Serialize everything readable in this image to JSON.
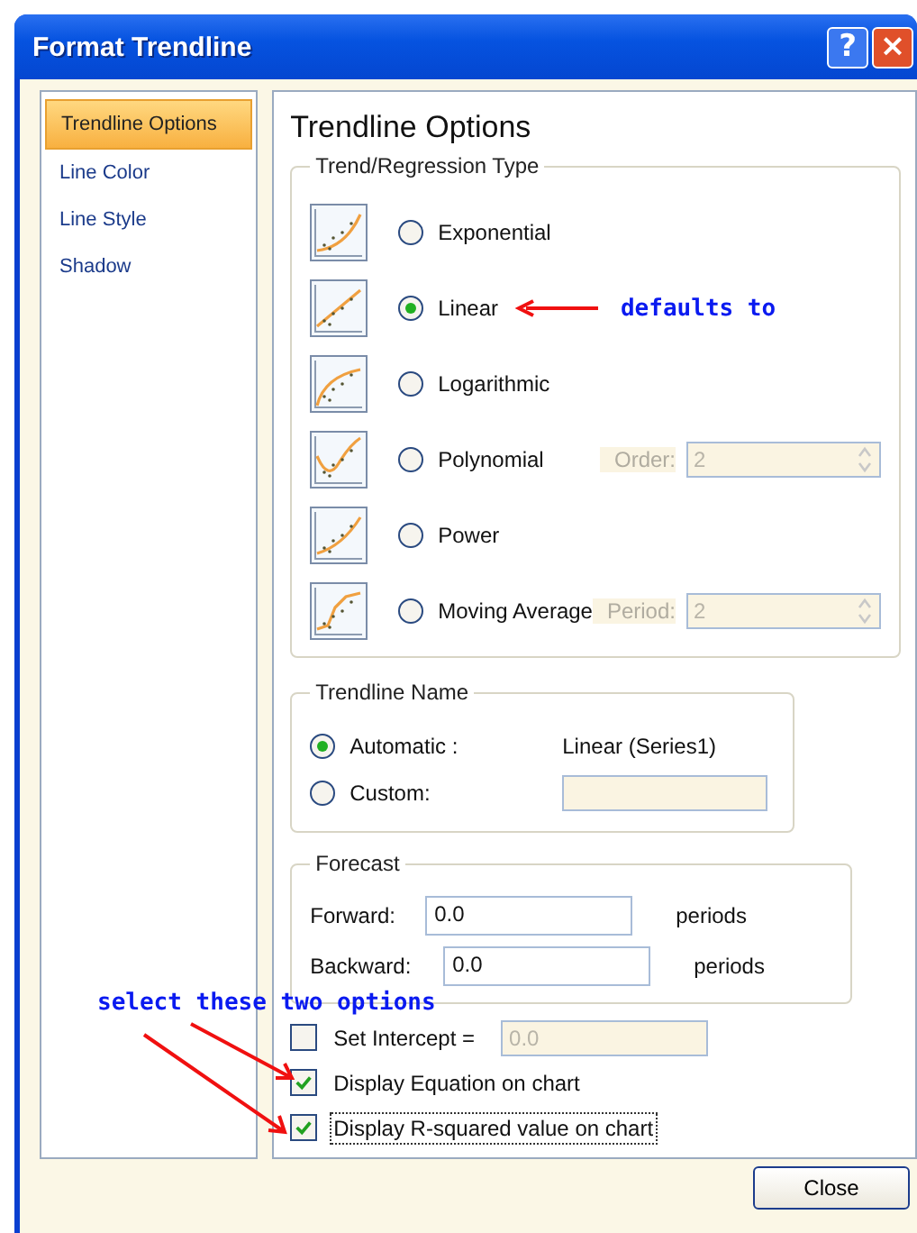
{
  "window": {
    "title": "Format Trendline"
  },
  "title_buttons": [
    "?",
    "×"
  ],
  "sidebar": {
    "items": [
      {
        "label": "Trendline Options",
        "selected": true
      },
      {
        "label": "Line Color",
        "selected": false
      },
      {
        "label": "Line Style",
        "selected": false
      },
      {
        "label": "Shadow",
        "selected": false
      }
    ]
  },
  "panel": {
    "heading": "Trendline Options",
    "trend_type": {
      "title": "Trend/Regression Type",
      "options": [
        {
          "kind": "exponential",
          "label": "Exponential",
          "selected": false
        },
        {
          "kind": "linear",
          "label": "Linear",
          "selected": true,
          "note": "defaults to"
        },
        {
          "kind": "logarithmic",
          "label": "Logarithmic",
          "selected": false
        },
        {
          "kind": "polynomial",
          "label": "Polynomial",
          "selected": false,
          "param": {
            "label": "Order:",
            "value": "2",
            "disabled": true
          }
        },
        {
          "kind": "power",
          "label": "Power",
          "selected": false
        },
        {
          "kind": "moving_average",
          "label": "Moving Average",
          "selected": false,
          "param": {
            "label": "Period:",
            "value": "2",
            "disabled": true
          }
        }
      ]
    },
    "trendline_name": {
      "title": "Trendline Name",
      "options": [
        {
          "label": "Automatic :",
          "selected": true,
          "value": "Linear (Series1)"
        },
        {
          "label": "Custom:",
          "selected": false,
          "field": {
            "disabled": true
          }
        }
      ]
    },
    "forecast": {
      "title": "Forecast",
      "rows": [
        {
          "label": "Forward:",
          "value": "0.0",
          "unit": "periods"
        },
        {
          "label": "Backward:",
          "value": "0.0",
          "unit": "periods"
        }
      ]
    },
    "checks": [
      {
        "label": "Set Intercept =",
        "checked": false,
        "focused": false,
        "field": {
          "value": "0.0",
          "disabled": true
        }
      },
      {
        "label": "Display Equation on chart",
        "checked": true,
        "focused": false
      },
      {
        "label": "Display R-squared value on chart",
        "checked": true,
        "focused": true
      }
    ]
  },
  "annotation": "select these two options",
  "buttons": [
    "Close"
  ]
}
